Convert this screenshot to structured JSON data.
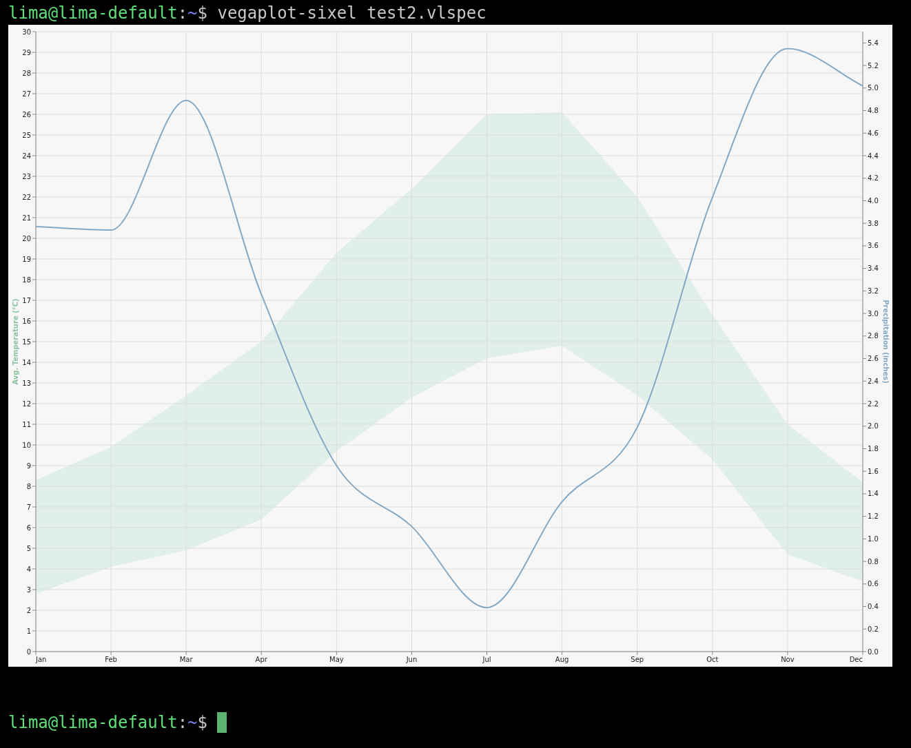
{
  "terminal": {
    "lines": [
      {
        "kind": "prompt",
        "user_host": "lima@lima-default",
        "separator": ":",
        "path": "~",
        "symbol": "$",
        "command": "vegaplot-sixel test2.vlspec"
      },
      {
        "kind": "chart",
        "chart_data": {
          "type": "area",
          "ylabel": "Avg. Temperature (°C)",
          "y2label": "Precipitation (inches)",
          "categories": [
            "Jan",
            "Feb",
            "Mar",
            "Apr",
            "May",
            "Jun",
            "Jul",
            "Aug",
            "Sep",
            "Oct",
            "Nov",
            "Dec"
          ],
          "series": [
            {
              "color": "#e0efe8",
              "values": [
                8.3,
                9.9,
                12.4,
                15.0,
                19.3,
                22.4,
                26.0,
                26.1,
                22.0,
                16.3,
                11.0,
                8.2
              ]
            },
            {
              "color": "#f7f7f7",
              "values": [
                2.8,
                4.1,
                4.9,
                6.4,
                9.7,
                12.3,
                14.2,
                14.8,
                12.4,
                9.3,
                4.7,
                3.4
              ]
            },
            {
              "type": "line",
              "color": "#85a9c5",
              "axis": "y2",
              "values": [
                3.77,
                3.74,
                4.89,
                3.17,
                1.65,
                1.11,
                0.39,
                1.33,
                1.99,
                4.03,
                5.35,
                5.02
              ]
            }
          ],
          "grid": true,
          "ylim": [
            0,
            30
          ],
          "yticks": [
            0,
            1,
            2,
            3,
            4,
            5,
            6,
            7,
            8,
            9,
            10,
            11,
            12,
            13,
            14,
            15,
            16,
            17,
            18,
            19,
            20,
            21,
            22,
            23,
            24,
            25,
            26,
            27,
            28,
            29,
            30
          ],
          "y2lim": [
            0,
            5.5
          ],
          "y2ticks": [
            {
              "value": 0,
              "label": "0.0"
            },
            {
              "value": 0.2,
              "label": "0.2"
            },
            {
              "value": 0.4,
              "label": "0.4"
            },
            {
              "value": 0.6,
              "label": "0.6"
            },
            {
              "value": 0.8,
              "label": "0.8"
            },
            {
              "value": 1,
              "label": "1.0"
            },
            {
              "value": 1.2,
              "label": "1.2"
            },
            {
              "value": 1.4,
              "label": "1.4"
            },
            {
              "value": 1.6,
              "label": "1.6"
            },
            {
              "value": 1.8,
              "label": "1.8"
            },
            {
              "value": 2,
              "label": "2.0"
            },
            {
              "value": 2.2,
              "label": "2.2"
            },
            {
              "value": 2.4,
              "label": "2.4"
            },
            {
              "value": 2.6,
              "label": "2.6"
            },
            {
              "value": 2.8,
              "label": "2.8"
            },
            {
              "value": 3,
              "label": "3.0"
            },
            {
              "value": 3.2,
              "label": "3.2"
            },
            {
              "value": 3.4,
              "label": "3.4"
            },
            {
              "value": 3.6,
              "label": "3.6"
            },
            {
              "value": 3.8,
              "label": "3.8"
            },
            {
              "value": 4,
              "label": "4.0"
            },
            {
              "value": 4.2,
              "label": "4.2"
            },
            {
              "value": 4.4,
              "label": "4.4"
            },
            {
              "value": 4.6,
              "label": "4.6"
            },
            {
              "value": 4.8,
              "label": "4.8"
            },
            {
              "value": 5,
              "label": "5.0"
            },
            {
              "value": 5.2,
              "label": "5.2"
            },
            {
              "value": 5.4,
              "label": "5.4"
            }
          ]
        }
      },
      {
        "kind": "prompt",
        "user_host": "lima@lima-default",
        "separator": ":",
        "path": "~",
        "symbol": "$",
        "cursor": true
      }
    ]
  }
}
